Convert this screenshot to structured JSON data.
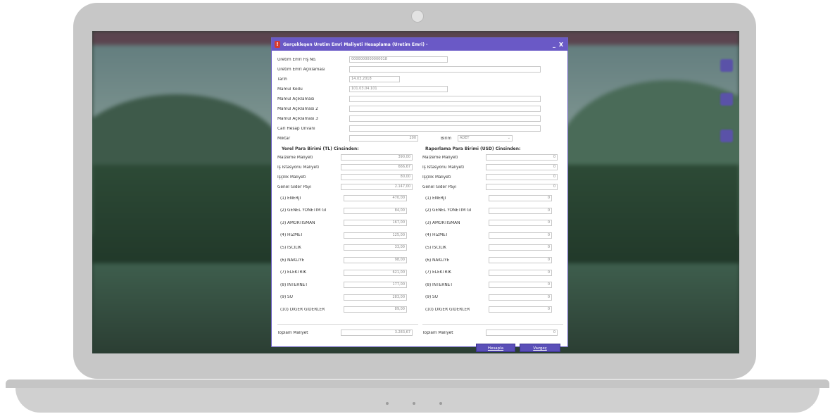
{
  "dialog": {
    "title": "Gerçekleşen Üretim Emri Maliyeti Hesaplama (Üretim Emri) -",
    "minimize": "_",
    "close": "X",
    "fields": {
      "fis_no": {
        "label": "Üretim Emri Fiş No.",
        "value": "0000000000000018"
      },
      "aciklama": {
        "label": "Üretim Emri Açıklaması",
        "value": ""
      },
      "tarih": {
        "label": "Tarih",
        "value": "14.03.2018"
      },
      "mamul_kodu": {
        "label": "Mamul Kodu",
        "value": "101.03.04.101"
      },
      "mamul_aciklamasi": {
        "label": "Mamul Açıklaması",
        "value": ""
      },
      "mamul_aciklamasi2": {
        "label": "Mamul Açıklaması 2",
        "value": ""
      },
      "mamul_aciklamasi3": {
        "label": "Mamul Açıklaması 3",
        "value": ""
      },
      "cari_hesap": {
        "label": "Cari Hesap Unvanı",
        "value": ""
      },
      "miktar": {
        "label": "Miktar",
        "value": "200"
      },
      "birim": {
        "label": "Birim",
        "value": "ADET"
      }
    },
    "local": {
      "header": "Yerel Para Birimi (TL) Cinsinden:",
      "rows": [
        {
          "label": "Malzeme Maliyeti",
          "value": "390,00"
        },
        {
          "label": "İş İstasyonu Maliyeti",
          "value": "666,67"
        },
        {
          "label": "İşçilik Maliyeti",
          "value": "80,00"
        },
        {
          "label": "Genel Gider Payı",
          "value": "2.147,00"
        }
      ],
      "expenses": [
        {
          "label": "(1) ENERJI",
          "value": "470,00"
        },
        {
          "label": "(2) GENEL YONETIM GI",
          "value": "84,00"
        },
        {
          "label": "(3) AMORTISMAN",
          "value": "167,00"
        },
        {
          "label": "(4) HIZMET",
          "value": "125,00"
        },
        {
          "label": "(5) ISCILIK",
          "value": "33,00"
        },
        {
          "label": "(6) NAKLIYE",
          "value": "98,00"
        },
        {
          "label": "(7) ELEKTRIK",
          "value": "621,00"
        },
        {
          "label": "(8) INTERNET",
          "value": "177,00"
        },
        {
          "label": "(9) SU",
          "value": "283,00"
        },
        {
          "label": "(10) DIGER GIDERLER",
          "value": "89,00"
        }
      ],
      "total": {
        "label": "Toplam Maliyet",
        "value": "3.283,67"
      }
    },
    "report": {
      "header": "Raporlama Para Birimi (USD) Cinsinden:",
      "rows": [
        {
          "label": "Malzeme Maliyeti",
          "value": "0"
        },
        {
          "label": "İş İstasyonu Maliyeti",
          "value": "0"
        },
        {
          "label": "İşçilik Maliyeti",
          "value": "0"
        },
        {
          "label": "Genel Gider Payı",
          "value": "0"
        }
      ],
      "expenses": [
        {
          "label": "(1) ENERJI",
          "value": "0"
        },
        {
          "label": "(2) GENEL YONETIM GI",
          "value": "0"
        },
        {
          "label": "(3) AMORTISMAN",
          "value": "0"
        },
        {
          "label": "(4) HIZMET",
          "value": "0"
        },
        {
          "label": "(5) ISCILIK",
          "value": "0"
        },
        {
          "label": "(6) NAKLIYE",
          "value": "0"
        },
        {
          "label": "(7) ELEKTRIK",
          "value": "0"
        },
        {
          "label": "(8) INTERNET",
          "value": "0"
        },
        {
          "label": "(9) SU",
          "value": "0"
        },
        {
          "label": "(10) DIGER GIDERLER",
          "value": "0"
        }
      ],
      "total": {
        "label": "Toplam Maliyet",
        "value": "0"
      }
    },
    "buttons": {
      "calculate": "Hesapla",
      "cancel": "Vazgeç"
    }
  },
  "colors": {
    "titlebar": "#6a59c6",
    "button": "#5a4fb8",
    "frame": "#c7c7c7"
  }
}
